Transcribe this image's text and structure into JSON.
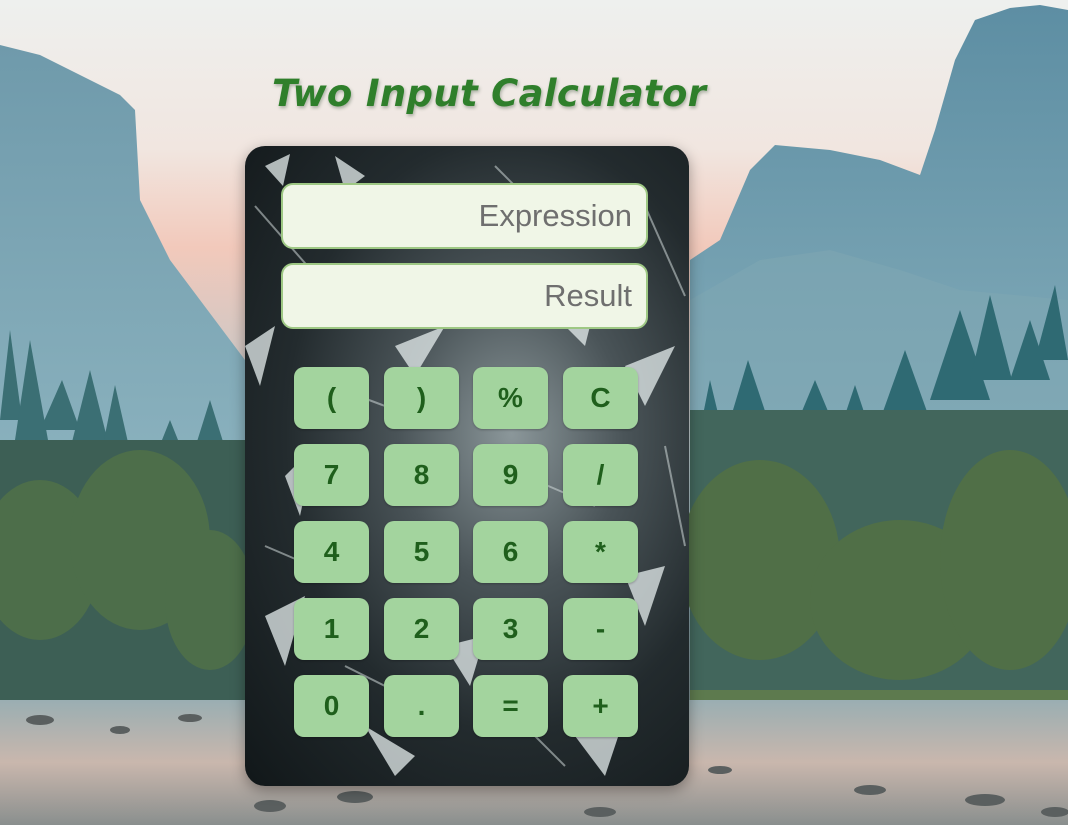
{
  "header": {
    "title": "Two Input Calculator"
  },
  "display": {
    "expression_placeholder": "Expression",
    "result_placeholder": "Result"
  },
  "keypad": {
    "rows": [
      [
        "(",
        ")",
        "%",
        "C"
      ],
      [
        "7",
        "8",
        "9",
        "/"
      ],
      [
        "4",
        "5",
        "6",
        "*"
      ],
      [
        "1",
        "2",
        "3",
        "-"
      ],
      [
        "0",
        ".",
        "=",
        "+"
      ]
    ]
  },
  "colors": {
    "title": "#2f7f2b",
    "button_bg": "#a3d49e",
    "button_text": "#1f5f1c",
    "field_bg": "#f0f6e7",
    "field_border": "#9ec884"
  }
}
